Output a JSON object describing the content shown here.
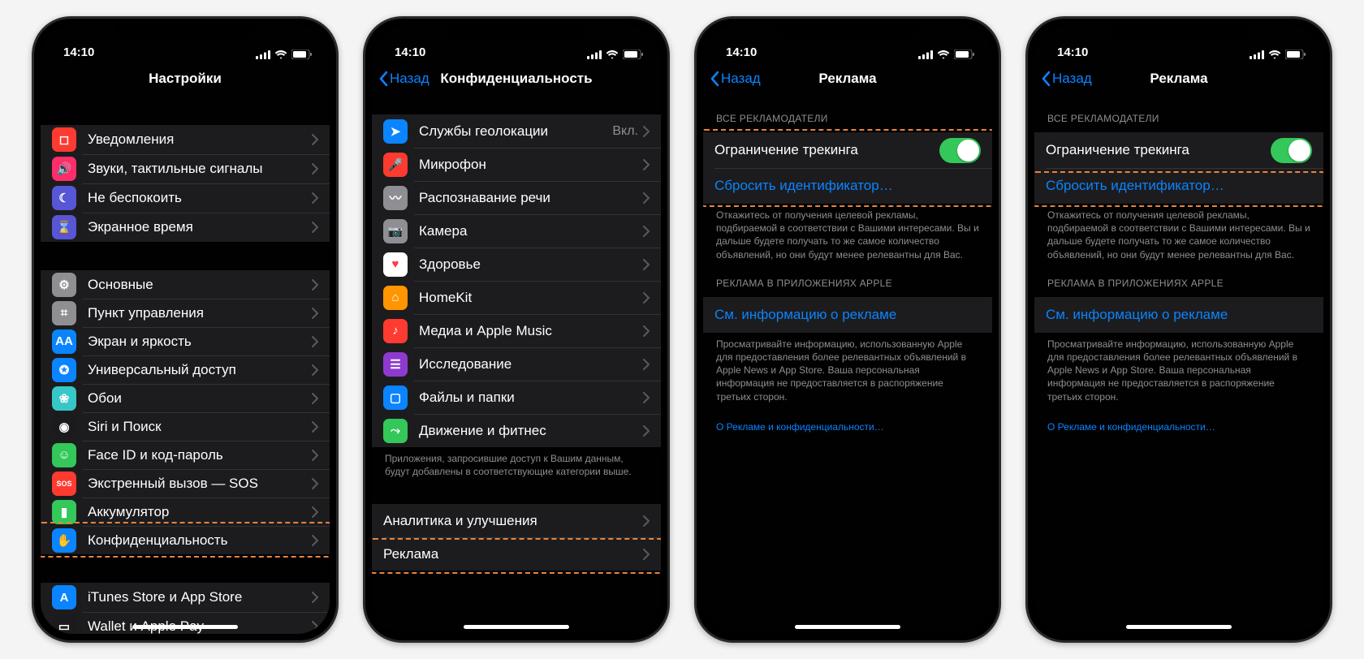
{
  "status": {
    "time": "14:10"
  },
  "nav": {
    "back": "Назад"
  },
  "screen1": {
    "title": "Настройки",
    "group1": [
      {
        "name": "notifications",
        "label": "Уведомления",
        "color": "#ff3a30"
      },
      {
        "name": "sounds",
        "label": "Звуки, тактильные сигналы",
        "color": "#ff2d69"
      },
      {
        "name": "dnd",
        "label": "Не беспокоить",
        "color": "#5756d4"
      },
      {
        "name": "screentime",
        "label": "Экранное время",
        "color": "#5756d4"
      }
    ],
    "group2": [
      {
        "name": "general",
        "label": "Основные",
        "color": "#8e8e93"
      },
      {
        "name": "control-center",
        "label": "Пункт управления",
        "color": "#8e8e93"
      },
      {
        "name": "display",
        "label": "Экран и яркость",
        "color": "#0a84ff"
      },
      {
        "name": "accessibility",
        "label": "Универсальный доступ",
        "color": "#0a84ff"
      },
      {
        "name": "wallpaper",
        "label": "Обои",
        "color": "#38c7c7"
      },
      {
        "name": "siri",
        "label": "Siri и Поиск",
        "color": "#1b1b1d"
      },
      {
        "name": "faceid",
        "label": "Face ID и код-пароль",
        "color": "#34c759"
      },
      {
        "name": "sos",
        "label": "Экстренный вызов — SOS",
        "color": "#ff3a30",
        "text": "SOS"
      },
      {
        "name": "battery",
        "label": "Аккумулятор",
        "color": "#34c759"
      },
      {
        "name": "privacy",
        "label": "Конфиденциальность",
        "color": "#0a84ff"
      }
    ],
    "group3": [
      {
        "name": "itunes",
        "label": "iTunes Store и App Store",
        "color": "#0a84ff"
      },
      {
        "name": "wallet",
        "label": "Wallet и Apple Pay",
        "color": "#1b1b1d"
      }
    ]
  },
  "screen2": {
    "title": "Конфиденциальность",
    "group1": [
      {
        "name": "location",
        "label": "Службы геолокации",
        "color": "#0a84ff",
        "detail": "Вкл."
      },
      {
        "name": "microphone",
        "label": "Микрофон",
        "color": "#ff3a30"
      },
      {
        "name": "speech",
        "label": "Распознавание речи",
        "color": "#8e8e93"
      },
      {
        "name": "camera",
        "label": "Камера",
        "color": "#8e8e93"
      },
      {
        "name": "health",
        "label": "Здоровье",
        "color": "#ffffff"
      },
      {
        "name": "homekit",
        "label": "HomeKit",
        "color": "#ff9500"
      },
      {
        "name": "media",
        "label": "Медиа и Apple Music",
        "color": "#ff3a30"
      },
      {
        "name": "research",
        "label": "Исследование",
        "color": "#8e3acf"
      },
      {
        "name": "files",
        "label": "Файлы и папки",
        "color": "#0a84ff"
      },
      {
        "name": "motion",
        "label": "Движение и фитнес",
        "color": "#34c759"
      }
    ],
    "footer1": "Приложения, запросившие доступ к Вашим данным, будут добавлены в соответствующие категории выше.",
    "group2": [
      {
        "name": "analytics",
        "label": "Аналитика и улучшения"
      },
      {
        "name": "advertising",
        "label": "Реклама"
      }
    ]
  },
  "screen3": {
    "title": "Реклама",
    "header1": "ВСЕ РЕКЛАМОДАТЕЛИ",
    "limit_tracking": "Ограничение трекинга",
    "reset_id": "Сбросить идентификатор…",
    "footer1": "Откажитесь от получения целевой рекламы, подбираемой в соответствии с Вашими интересами. Вы и дальше будете получать то же самое количество объявлений, но они будут менее релевантны для Вас.",
    "header2": "РЕКЛАМА В ПРИЛОЖЕНИЯХ APPLE",
    "ad_info": "См. информацию о рекламе",
    "footer2": "Просматривайте информацию, использованную Apple для предоставления более релевантных объявлений в Apple News и App Store. Ваша персональная информация не предоставляется в распоряжение третьих сторон.",
    "about_link": "О Рекламе и конфиденциальности…"
  }
}
